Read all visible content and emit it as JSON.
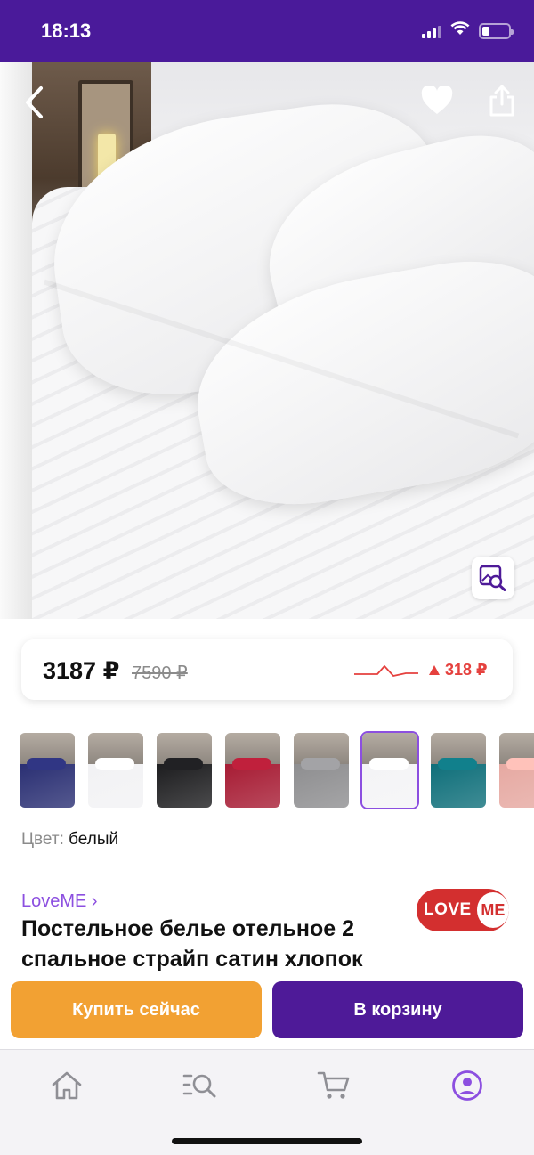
{
  "status_bar": {
    "time": "18:13",
    "icons": [
      "signal-icon",
      "wifi-icon",
      "battery-icon"
    ],
    "battery_level": 0.3
  },
  "header_actions": {
    "back_icon": "chevron-left-icon",
    "favorite_icon": "heart-icon",
    "share_icon": "share-icon",
    "image_search_icon": "image-search-icon"
  },
  "price": {
    "current": "3187 ₽",
    "old": "7590 ₽",
    "change": "318 ₽",
    "change_direction": "up",
    "change_color": "#e5413e"
  },
  "variants": [
    {
      "name": "navy",
      "color": "#2a2f73",
      "selected": false
    },
    {
      "name": "white",
      "color": "#f2f2f4",
      "selected": false
    },
    {
      "name": "black",
      "color": "#1d1d1f",
      "selected": false
    },
    {
      "name": "burgundy",
      "color": "#a71c34",
      "selected": false
    },
    {
      "name": "grey",
      "color": "#8e8e90",
      "selected": false
    },
    {
      "name": "white-selected",
      "color": "#f4f4f6",
      "selected": true
    },
    {
      "name": "teal",
      "color": "#0f6f7a",
      "selected": false
    },
    {
      "name": "pink",
      "color": "#e6a9a2",
      "selected": false
    }
  ],
  "color": {
    "label": "Цвет:",
    "value": "белый"
  },
  "seller": {
    "name": "LoveME ›",
    "logo_love": "LOVE",
    "logo_me": "ME",
    "logo_color": "#d32f2f"
  },
  "product": {
    "title": "Постельное белье отельное 2 спальное страйп сатин хлопок"
  },
  "actions": {
    "buy_now": "Купить сейчас",
    "add_to_cart": "В корзину",
    "buy_color": "#f2a133",
    "cart_color": "#4e1a98"
  },
  "tab_bar": {
    "tabs": [
      {
        "icon": "home-icon",
        "active": false
      },
      {
        "icon": "catalog-search-icon",
        "active": false
      },
      {
        "icon": "cart-icon",
        "active": false
      },
      {
        "icon": "profile-icon",
        "active": true
      }
    ],
    "active_color": "#8c4fe0"
  },
  "accent_color": "#4a1a9a"
}
